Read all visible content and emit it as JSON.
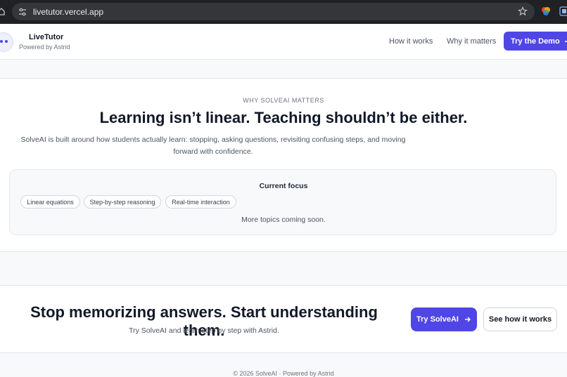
{
  "browser": {
    "url": "livetutor.vercel.app"
  },
  "header": {
    "brand_name": "LiveTutor",
    "brand_sub": "Powered by Astrid",
    "nav": [
      "How it works",
      "Why it matters"
    ],
    "demo_label": "Try the Demo"
  },
  "matters": {
    "eyebrow": "WHY SOLVEAI MATTERS",
    "headline": "Learning isn’t linear. Teaching shouldn’t be either.",
    "lede": "SolveAI is built around how students actually learn: stopping, asking questions, revisiting confusing steps, and moving forward with confidence.",
    "focus_title": "Current focus",
    "chips": [
      "Linear equations",
      "Step-by-step reasoning",
      "Real-time interaction"
    ],
    "focus_note": "More topics coming soon."
  },
  "cta": {
    "title": "Stop memorizing answers. Start understanding them.",
    "subtitle": "Try SolveAI and learn step by step with Astrid.",
    "primary_label": "Try SolveAI",
    "secondary_label": "See how it works"
  },
  "footer": {
    "text": "© 2026 SolveAI · Powered by Astrid"
  },
  "colors": {
    "accent": "#4f46e5",
    "chrome": "#202124"
  },
  "icons": [
    "home-icon",
    "site-info-icon",
    "star-icon",
    "extension-color-icon",
    "extension-grid-icon",
    "arrow-right-icon"
  ]
}
